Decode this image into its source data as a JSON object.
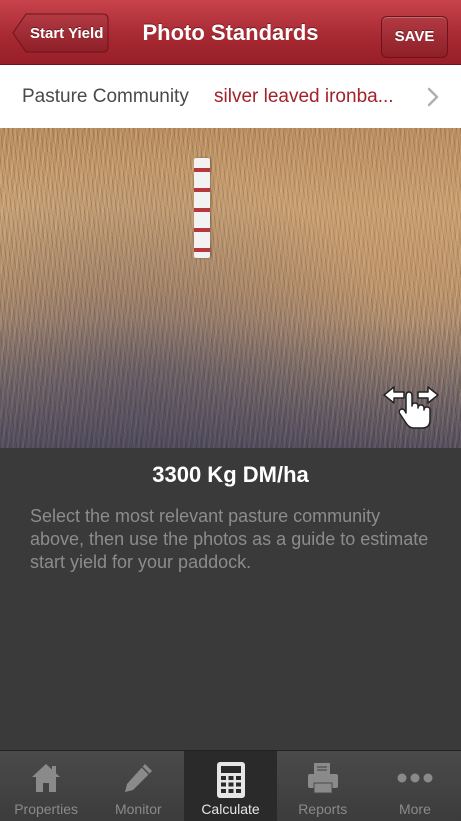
{
  "nav": {
    "back_label": "Start Yield",
    "title": "Photo Standards",
    "save_label": "SAVE"
  },
  "pasture": {
    "label": "Pasture Community",
    "value": "silver leaved ironba..."
  },
  "yield": {
    "value": "3300 Kg DM/ha"
  },
  "instructions": "Select the most relevant pasture community above, then use the photos as a guide to estimate start yield for your paddock.",
  "tabs": [
    {
      "label": "Properties",
      "icon": "house-icon",
      "active": false
    },
    {
      "label": "Monitor",
      "icon": "pencil-icon",
      "active": false
    },
    {
      "label": "Calculate",
      "icon": "calculator-icon",
      "active": true
    },
    {
      "label": "Reports",
      "icon": "printer-icon",
      "active": false
    },
    {
      "label": "More",
      "icon": "more-icon",
      "active": false
    }
  ],
  "colors": {
    "brand": "#a82a33",
    "pasture_value": "#a2222c",
    "background": "#3a3a3a"
  }
}
